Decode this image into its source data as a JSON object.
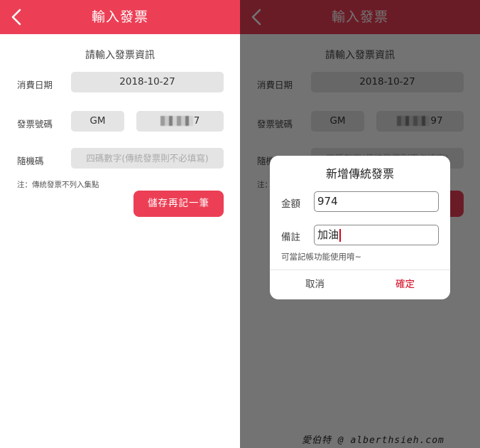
{
  "header": {
    "title": "輸入發票"
  },
  "form": {
    "heading": "請輸入發票資訊",
    "date_label": "消費日期",
    "date_value": "2018-10-27",
    "invoice_label": "發票號碼",
    "invoice_prefix": "GM",
    "invoice_suffix_left": "7",
    "invoice_suffix_right": "97",
    "random_code_label": "隨機碼",
    "random_code_placeholder": "四碼數字(傳統發票則不必填寫)",
    "note": "注：傳統發票不列入集點",
    "save_button": "儲存再記一筆"
  },
  "dialog": {
    "title": "新增傳統發票",
    "amount_label": "金額",
    "amount_value": "974",
    "remark_label": "備註",
    "remark_value": "加油",
    "hint": "可當記帳功能使用唷~",
    "cancel_button": "取消",
    "confirm_button": "確定"
  },
  "watermark": "愛伯特 @ alberthsieh.com",
  "colors": {
    "brand_red": "#ec3f55",
    "confirm_red": "#d0021b",
    "field_gray": "#e4e4e4",
    "overlay": "rgba(0,0,0,0.55)"
  },
  "icons": {
    "back": "chevron-left-icon",
    "redacted": "pixelated-redaction"
  }
}
